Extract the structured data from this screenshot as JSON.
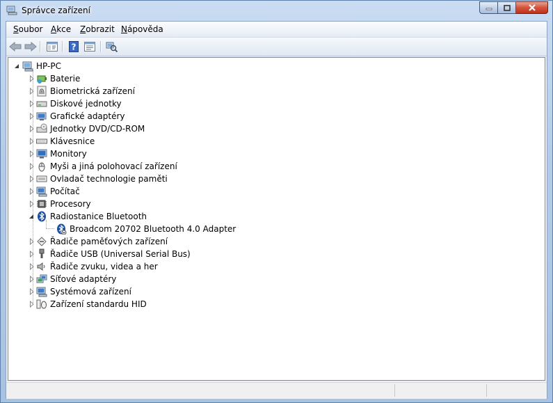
{
  "window": {
    "title": "Správce zařízení",
    "title_icon": "device-manager-icon"
  },
  "menu": [
    {
      "key": "S",
      "rest": "oubor"
    },
    {
      "key": "A",
      "rest": "kce"
    },
    {
      "key": "Z",
      "rest": "obrazit"
    },
    {
      "key": "N",
      "rest": "ápověda"
    }
  ],
  "toolbar": [
    "back-arrow-icon",
    "forward-arrow-icon",
    "show-hide-console-tree-icon",
    "help-icon",
    "properties-icon",
    "scan-hardware-icon"
  ],
  "tree": {
    "root": "HP-PC",
    "categories": [
      "Baterie",
      "Biometrická zařízení",
      "Diskové jednotky",
      "Grafické adaptéry",
      "Jednotky DVD/CD-ROM",
      "Klávesnice",
      "Monitory",
      "Myši a jiná polohovací zařízení",
      "Ovladač technologie paměti",
      "Počítač",
      "Procesory",
      "Radiostanice Bluetooth",
      "Řadiče paměťových zařízení",
      "Řadiče USB (Universal Serial Bus)",
      "Řadiče zvuku, videa a her",
      "Síťové adaptéry",
      "Systémová zařízení",
      "Zařízení standardu HID"
    ],
    "bluetooth_child": "Broadcom 20702 Bluetooth 4.0 Adapter"
  }
}
